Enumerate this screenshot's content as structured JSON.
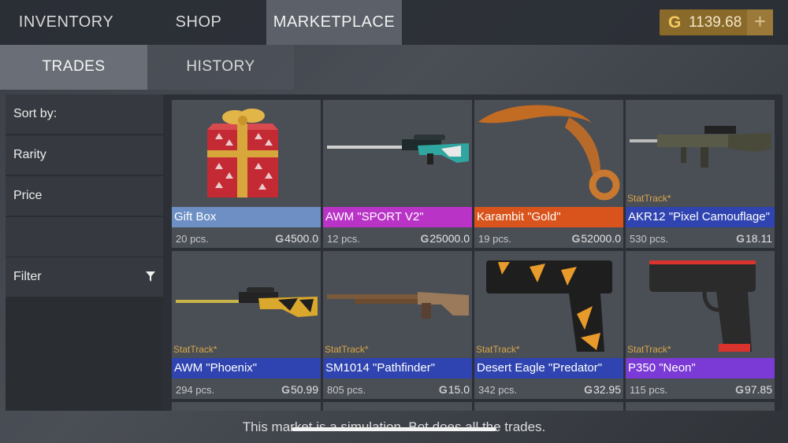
{
  "top_tabs": [
    {
      "label": "INVENTORY"
    },
    {
      "label": "SHOP"
    },
    {
      "label": "MARKETPLACE",
      "active": true
    }
  ],
  "balance": {
    "currency_icon": "gold-g-coin-icon",
    "value": "1139.68",
    "add_icon": "plus-icon",
    "color": "#8a6a2a"
  },
  "sub_tabs": [
    {
      "label": "TRADES",
      "active": true
    },
    {
      "label": "HISTORY"
    }
  ],
  "sidebar": {
    "sort_label": "Sort by:",
    "sort_options": [
      "Rarity",
      "Price"
    ],
    "filter_label": "Filter",
    "filter_icon": "funnel-icon"
  },
  "items": [
    {
      "name": "Gift Box",
      "qty": "20 pcs.",
      "price": "4500.0",
      "stattrack": "",
      "rarity_color": "#6d8fc4",
      "icon": "gift-box-icon"
    },
    {
      "name": "AWM \"SPORT V2\"",
      "qty": "12 pcs.",
      "price": "25000.0",
      "stattrack": "",
      "rarity_color": "#b933c7",
      "icon": "sniper-rifle-icon"
    },
    {
      "name": "Karambit \"Gold\"",
      "qty": "19 pcs.",
      "price": "52000.0",
      "stattrack": "",
      "rarity_color": "#d8541c",
      "icon": "karambit-knife-icon"
    },
    {
      "name": "AKR12 \"Pixel Camouflage\"",
      "qty": "530 pcs.",
      "price": "18.11",
      "stattrack": "StatTrack*",
      "rarity_color": "#2f44b0",
      "icon": "assault-rifle-icon"
    },
    {
      "name": "AWM \"Phoenix\"",
      "qty": "294 pcs.",
      "price": "50.99",
      "stattrack": "StatTrack*",
      "rarity_color": "#2f44b0",
      "icon": "sniper-rifle-icon"
    },
    {
      "name": "SM1014 \"Pathfinder\"",
      "qty": "805 pcs.",
      "price": "15.0",
      "stattrack": "StatTrack*",
      "rarity_color": "#2f44b0",
      "icon": "shotgun-icon"
    },
    {
      "name": "Desert Eagle \"Predator\"",
      "qty": "342 pcs.",
      "price": "32.95",
      "stattrack": "StatTrack*",
      "rarity_color": "#2f44b0",
      "icon": "pistol-icon"
    },
    {
      "name": "P350 \"Neon\"",
      "qty": "115 pcs.",
      "price": "97.85",
      "stattrack": "StatTrack*",
      "rarity_color": "#7b3ad6",
      "icon": "pistol-icon"
    }
  ],
  "price_currency_symbol": "G",
  "footer": {
    "disclaimer": "This market is a simulation. Bot does all the trades."
  }
}
